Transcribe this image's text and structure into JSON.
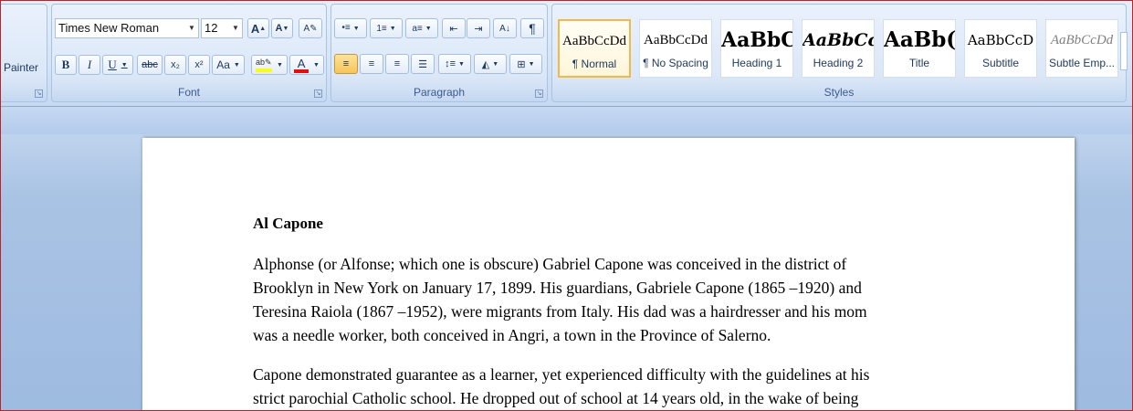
{
  "clipboard": {
    "painter_label": "Painter"
  },
  "font_group": {
    "label": "Font",
    "font_name": "Times New Roman",
    "font_size": "12",
    "grow_label": "A",
    "shrink_label": "A",
    "bold": "B",
    "italic": "I",
    "underline": "U",
    "strike": "abc",
    "subscript": "x₂",
    "superscript": "x²",
    "change_case": "Aa",
    "highlight_color": "#ffff00",
    "font_color": "#e01010"
  },
  "paragraph_group": {
    "label": "Paragraph",
    "show_marks": "¶"
  },
  "styles_group": {
    "label": "Styles",
    "items": [
      {
        "sample": "AaBbCcDd",
        "name": "¶ Normal"
      },
      {
        "sample": "AaBbCcDd",
        "name": "¶ No Spacing"
      },
      {
        "sample": "AaBbC",
        "name": "Heading 1"
      },
      {
        "sample": "AaBbCc",
        "name": "Heading 2"
      },
      {
        "sample": "AaBb(",
        "name": "Title"
      },
      {
        "sample": "AaBbCcD",
        "name": "Subtitle"
      },
      {
        "sample": "AaBbCcDd",
        "name": "Subtle Emp..."
      }
    ]
  },
  "document": {
    "title": "Al Capone",
    "para1": [
      "Alphonse (or Alfonse; which one is obscure) Gabriel Capone was conceived in the district of",
      "Brooklyn in New York on January 17, 1899. His guardians, Gabriele Capone (1865 –1920) and",
      "Teresina Raiola (1867 –1952), were migrants from Italy. His dad was a hairdresser and his mom",
      "was a needle worker, both conceived in Angri, a town in the Province of Salerno."
    ],
    "para2": [
      "Capone demonstrated guarantee as a learner, yet experienced difficulty with the guidelines at his",
      "strict parochial Catholic school. He dropped out of school at 14 years old, in the wake of being"
    ]
  }
}
